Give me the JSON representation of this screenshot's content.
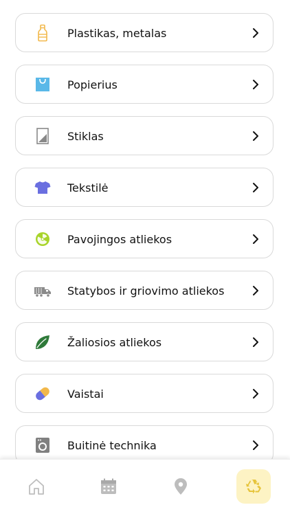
{
  "categories": [
    {
      "label": "Plastikas, metalas",
      "icon": "plastic-bottle-icon"
    },
    {
      "label": "Popierius",
      "icon": "paper-bag-icon"
    },
    {
      "label": "Stiklas",
      "icon": "glass-pane-icon"
    },
    {
      "label": "Tekstilė",
      "icon": "t-shirt-icon"
    },
    {
      "label": "Pavojingos atliekos",
      "icon": "radiation-icon"
    },
    {
      "label": "Statybos ir griovimo atliekos",
      "icon": "truck-icon"
    },
    {
      "label": "Žaliosios atliekos",
      "icon": "leaf-icon"
    },
    {
      "label": "Vaistai",
      "icon": "pill-icon"
    },
    {
      "label": "Buitinė technika",
      "icon": "washing-machine-icon"
    }
  ],
  "tabbar": {
    "tabs": [
      {
        "icon": "home-icon",
        "active": false
      },
      {
        "icon": "calendar-icon",
        "active": false
      },
      {
        "icon": "location-pin-icon",
        "active": false
      },
      {
        "icon": "recycle-icon",
        "active": true
      }
    ]
  },
  "colors": {
    "plastic": "#f2b84b",
    "paper": "#5ab8e8",
    "glass": "#888888",
    "textile": "#6a6fe0",
    "hazard": "#a8d42a",
    "construction": "#8a8a8a",
    "green": "#2f7a3a",
    "pill_a": "#6a6fe0",
    "pill_b": "#f2b84b",
    "appliance": "#808080",
    "tab_inactive": "#bdbdbd",
    "tab_active_bg": "#fdf3c4",
    "tab_active_icon": "#e6c43a"
  }
}
